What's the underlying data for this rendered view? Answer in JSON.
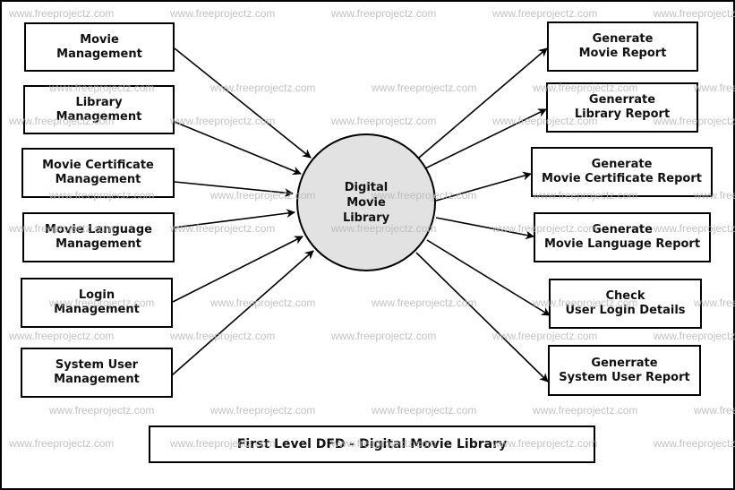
{
  "diagram": {
    "title": "First Level DFD - Digital Movie Library",
    "central_process": {
      "lines": [
        "Digital",
        "Movie",
        "Library"
      ],
      "fill_color": "#e2e2e2"
    },
    "input_entities": [
      {
        "id": "movie-management",
        "lines": [
          "Movie",
          "Management"
        ]
      },
      {
        "id": "library-management",
        "lines": [
          "Library",
          "Management"
        ]
      },
      {
        "id": "movie-certificate-management",
        "lines": [
          "Movie Certificate",
          "Management"
        ]
      },
      {
        "id": "movie-language-management",
        "lines": [
          "Movie Language",
          "Management"
        ]
      },
      {
        "id": "login-management",
        "lines": [
          "Login",
          "Management"
        ]
      },
      {
        "id": "system-user-management",
        "lines": [
          "System User",
          "Management"
        ]
      }
    ],
    "output_entities": [
      {
        "id": "generate-movie-report",
        "lines": [
          "Generate",
          "Movie Report"
        ]
      },
      {
        "id": "generrate-library-report",
        "lines": [
          "Generrate",
          "Library Report"
        ]
      },
      {
        "id": "generate-movie-certificate-report",
        "lines": [
          "Generate",
          "Movie Certificate Report"
        ]
      },
      {
        "id": "generate-movie-language-report",
        "lines": [
          "Generate",
          "Movie Language Report"
        ]
      },
      {
        "id": "check-user-login-details",
        "lines": [
          "Check",
          "User Login Details"
        ]
      },
      {
        "id": "generrate-system-user-report",
        "lines": [
          "Generrate",
          "System User Report"
        ]
      }
    ],
    "flows": [
      {
        "from": "movie-management",
        "to": "central-process"
      },
      {
        "from": "library-management",
        "to": "central-process"
      },
      {
        "from": "movie-certificate-management",
        "to": "central-process"
      },
      {
        "from": "movie-language-management",
        "to": "central-process"
      },
      {
        "from": "login-management",
        "to": "central-process"
      },
      {
        "from": "system-user-management",
        "to": "central-process"
      },
      {
        "from": "central-process",
        "to": "generate-movie-report"
      },
      {
        "from": "central-process",
        "to": "generrate-library-report"
      },
      {
        "from": "central-process",
        "to": "generate-movie-certificate-report"
      },
      {
        "from": "central-process",
        "to": "generate-movie-language-report"
      },
      {
        "from": "central-process",
        "to": "check-user-login-details"
      },
      {
        "from": "central-process",
        "to": "generrate-system-user-report"
      }
    ]
  },
  "watermark": {
    "text": "www.freeprojectz.com",
    "color": "#b8b8b8"
  }
}
